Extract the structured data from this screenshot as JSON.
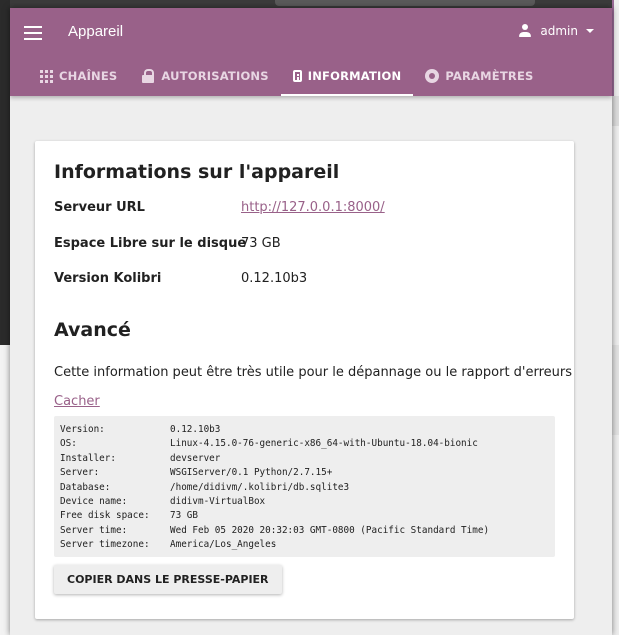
{
  "app": {
    "title": "Appareil",
    "user": "admin",
    "accent": "#996189"
  },
  "tabs": [
    {
      "label": "CHAÎNES",
      "icon": "grid-icon"
    },
    {
      "label": "AUTORISATIONS",
      "icon": "lock-icon"
    },
    {
      "label": "INFORMATION",
      "icon": "info-icon",
      "active": true
    },
    {
      "label": "PARAMÈTRES",
      "icon": "gear-icon"
    }
  ],
  "device_info": {
    "heading": "Informations sur l'appareil",
    "server_url_label": "Serveur URL",
    "server_url": "http://127.0.0.1:8000/",
    "free_space_label": "Espace Libre sur le disque",
    "free_space": "73 GB",
    "version_label": "Version Kolibri",
    "version": "0.12.10b3"
  },
  "advanced": {
    "heading": "Avancé",
    "description": "Cette information peut être très utile pour le dépannage ou le rapport d'erreurs",
    "hide_link": "Cacher",
    "copy_button": "COPIER DANS LE PRESSE-PAPIER",
    "debug": [
      {
        "key": "Version:",
        "value": "0.12.10b3"
      },
      {
        "key": "OS:",
        "value": "Linux-4.15.0-76-generic-x86_64-with-Ubuntu-18.04-bionic"
      },
      {
        "key": "Installer:",
        "value": "devserver"
      },
      {
        "key": "Server:",
        "value": "WSGIServer/0.1 Python/2.7.15+"
      },
      {
        "key": "Database:",
        "value": "/home/didivm/.kolibri/db.sqlite3"
      },
      {
        "key": "Device name:",
        "value": "didivm-VirtualBox"
      },
      {
        "key": "Free disk space:",
        "value": "73 GB"
      },
      {
        "key": "Server time:",
        "value": "Wed Feb 05 2020 20:32:03 GMT-0800 (Pacific Standard Time)"
      },
      {
        "key": "Server timezone:",
        "value": "America/Los_Angeles"
      }
    ]
  }
}
